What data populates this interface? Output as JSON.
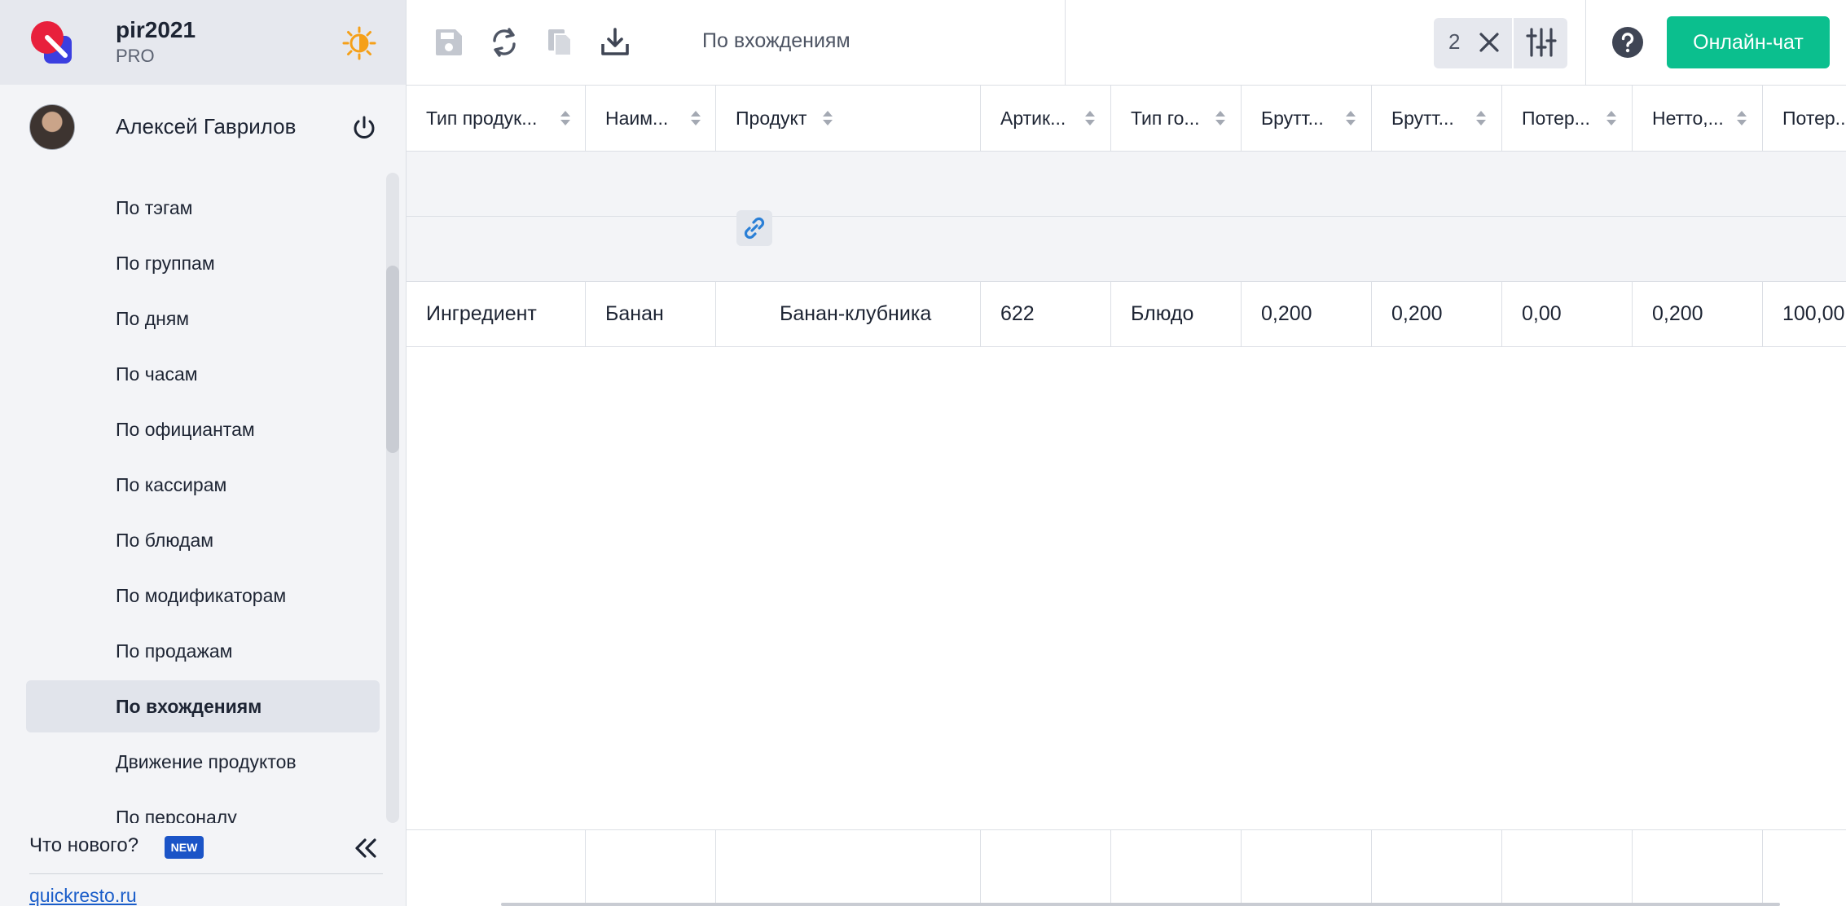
{
  "brand": {
    "name": "pir2021",
    "plan": "PRO"
  },
  "user": {
    "name": "Алексей Гаврилов"
  },
  "nav": {
    "items": [
      {
        "label": "По тэгам",
        "active": false
      },
      {
        "label": "По группам",
        "active": false
      },
      {
        "label": "По дням",
        "active": false
      },
      {
        "label": "По часам",
        "active": false
      },
      {
        "label": "По официантам",
        "active": false
      },
      {
        "label": "По кассирам",
        "active": false
      },
      {
        "label": "По блюдам",
        "active": false
      },
      {
        "label": "По модификаторам",
        "active": false
      },
      {
        "label": "По продажам",
        "active": false
      },
      {
        "label": "По вхождениям",
        "active": true
      },
      {
        "label": "Движение продуктов",
        "active": false
      },
      {
        "label": "По персоналу",
        "active": false
      }
    ]
  },
  "sidebar_footer": {
    "whats_new": "Что нового?",
    "new_badge": "NEW",
    "site_link": "quickresto.ru"
  },
  "toolbar": {
    "report_title": "По вхождениям",
    "filter_count": "2",
    "chat_label": "Онлайн-чат",
    "icons": [
      "save-icon",
      "refresh-icon",
      "copy-icon",
      "download-icon",
      "close-icon",
      "filter-settings-icon",
      "help-icon"
    ]
  },
  "table": {
    "columns": [
      "Тип продук...",
      "Наим...",
      "Продукт",
      "Артик...",
      "Тип го...",
      "Брутт...",
      "Брутт...",
      "Потер...",
      "Нетто,...",
      "Потер..."
    ],
    "row": [
      "Ингредиент",
      "Банан",
      "Банан-клубника",
      "622",
      "Блюдо",
      "0,200",
      "0,200",
      "0,00",
      "0,200",
      "100,00"
    ]
  },
  "colors": {
    "accent": "#0bbf8e",
    "badge": "#1b54c7",
    "link": "#1a5dc9",
    "logo_red": "#e8203c",
    "logo_blue": "#3b3fe0",
    "sun": "#f5a019"
  }
}
